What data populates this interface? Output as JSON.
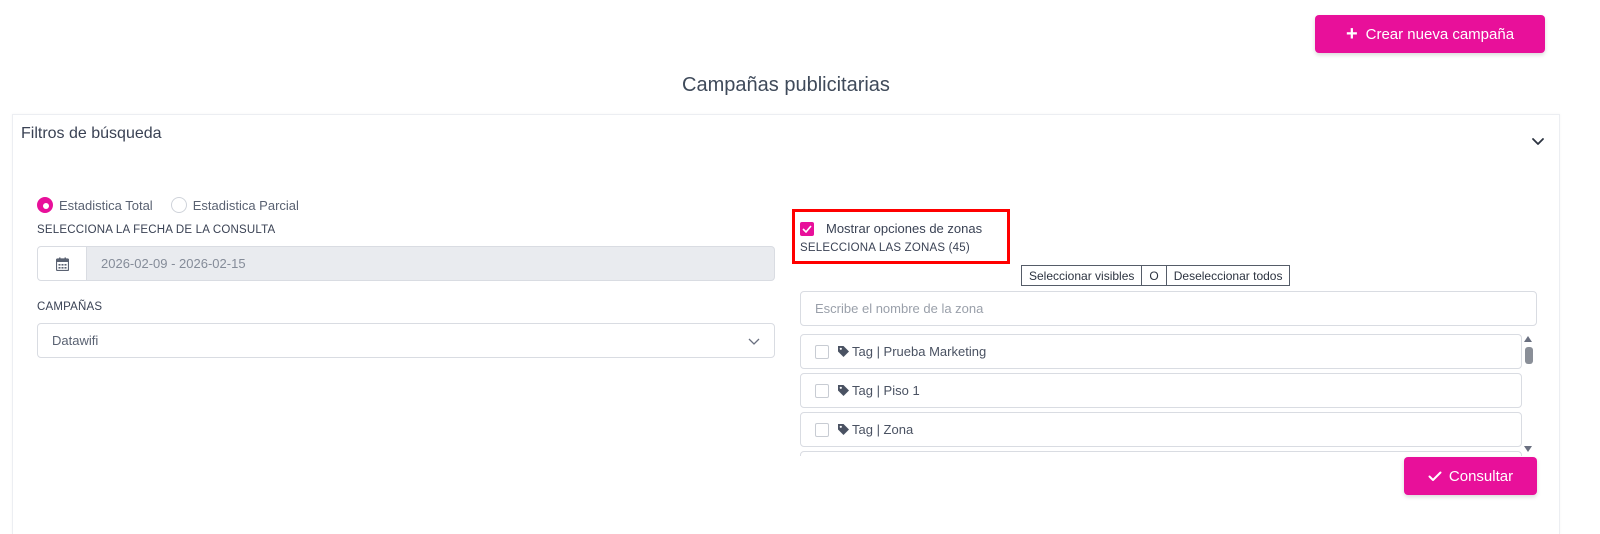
{
  "header": {
    "create_button_label": "Crear nueva campaña",
    "create_button_icon": "plus-icon",
    "page_title": "Campañas publicitarias"
  },
  "filters": {
    "title": "Filtros de búsqueda",
    "collapse_icon": "chevron-down-icon",
    "stat_options": [
      {
        "label": "Estadistica Total",
        "selected": true
      },
      {
        "label": "Estadistica Parcial",
        "selected": false
      }
    ],
    "date_label": "SELECCIONA LA FECHA DE LA CONSULTA",
    "date_value": "2026-02-09 - 2026-02-15",
    "date_icon": "calendar-icon",
    "campaigns_label": "CAMPAÑAS",
    "campaigns_selected": "Datawifi",
    "zones": {
      "show_options_label": "Mostrar opciones de zonas",
      "show_options_checked": true,
      "select_label": "SELECCIONA LAS ZONAS (45)",
      "select_visible_label": "Seleccionar visibles",
      "separator_label": "O",
      "deselect_all_label": "Deseleccionar todos",
      "search_placeholder": "Escribe el nombre de la zona",
      "items": [
        {
          "label": "Tag | Prueba Marketing",
          "checked": false
        },
        {
          "label": "Tag | Piso 1",
          "checked": false
        },
        {
          "label": "Tag | Zona",
          "checked": false
        }
      ]
    },
    "consult_button_label": "Consultar"
  },
  "colors": {
    "accent": "#e8109a",
    "highlight": "#ff0000"
  }
}
